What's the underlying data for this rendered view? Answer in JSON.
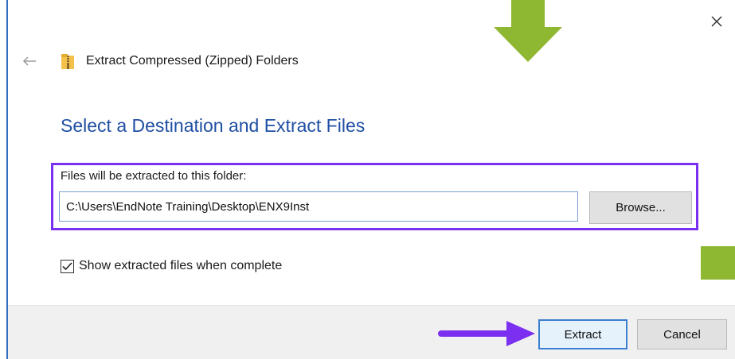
{
  "window": {
    "title": "Extract Compressed (Zipped) Folders",
    "close_icon": "close-icon",
    "back_icon": "back-arrow-icon",
    "folder_icon": "zip-folder-icon"
  },
  "main": {
    "heading": "Select a Destination and Extract Files",
    "destination": {
      "label": "Files will be extracted to this folder:",
      "path_value": "C:\\Users\\EndNote Training\\Desktop\\ENX9Inst",
      "browse_label": "Browse..."
    },
    "show_files": {
      "label": "Show extracted files when complete",
      "checked": true
    }
  },
  "footer": {
    "extract_label": "Extract",
    "cancel_label": "Cancel"
  },
  "annotations": {
    "green_color": "#8fb832",
    "purple_color": "#7b2ff0",
    "accent_blue": "#1f4fa3"
  }
}
